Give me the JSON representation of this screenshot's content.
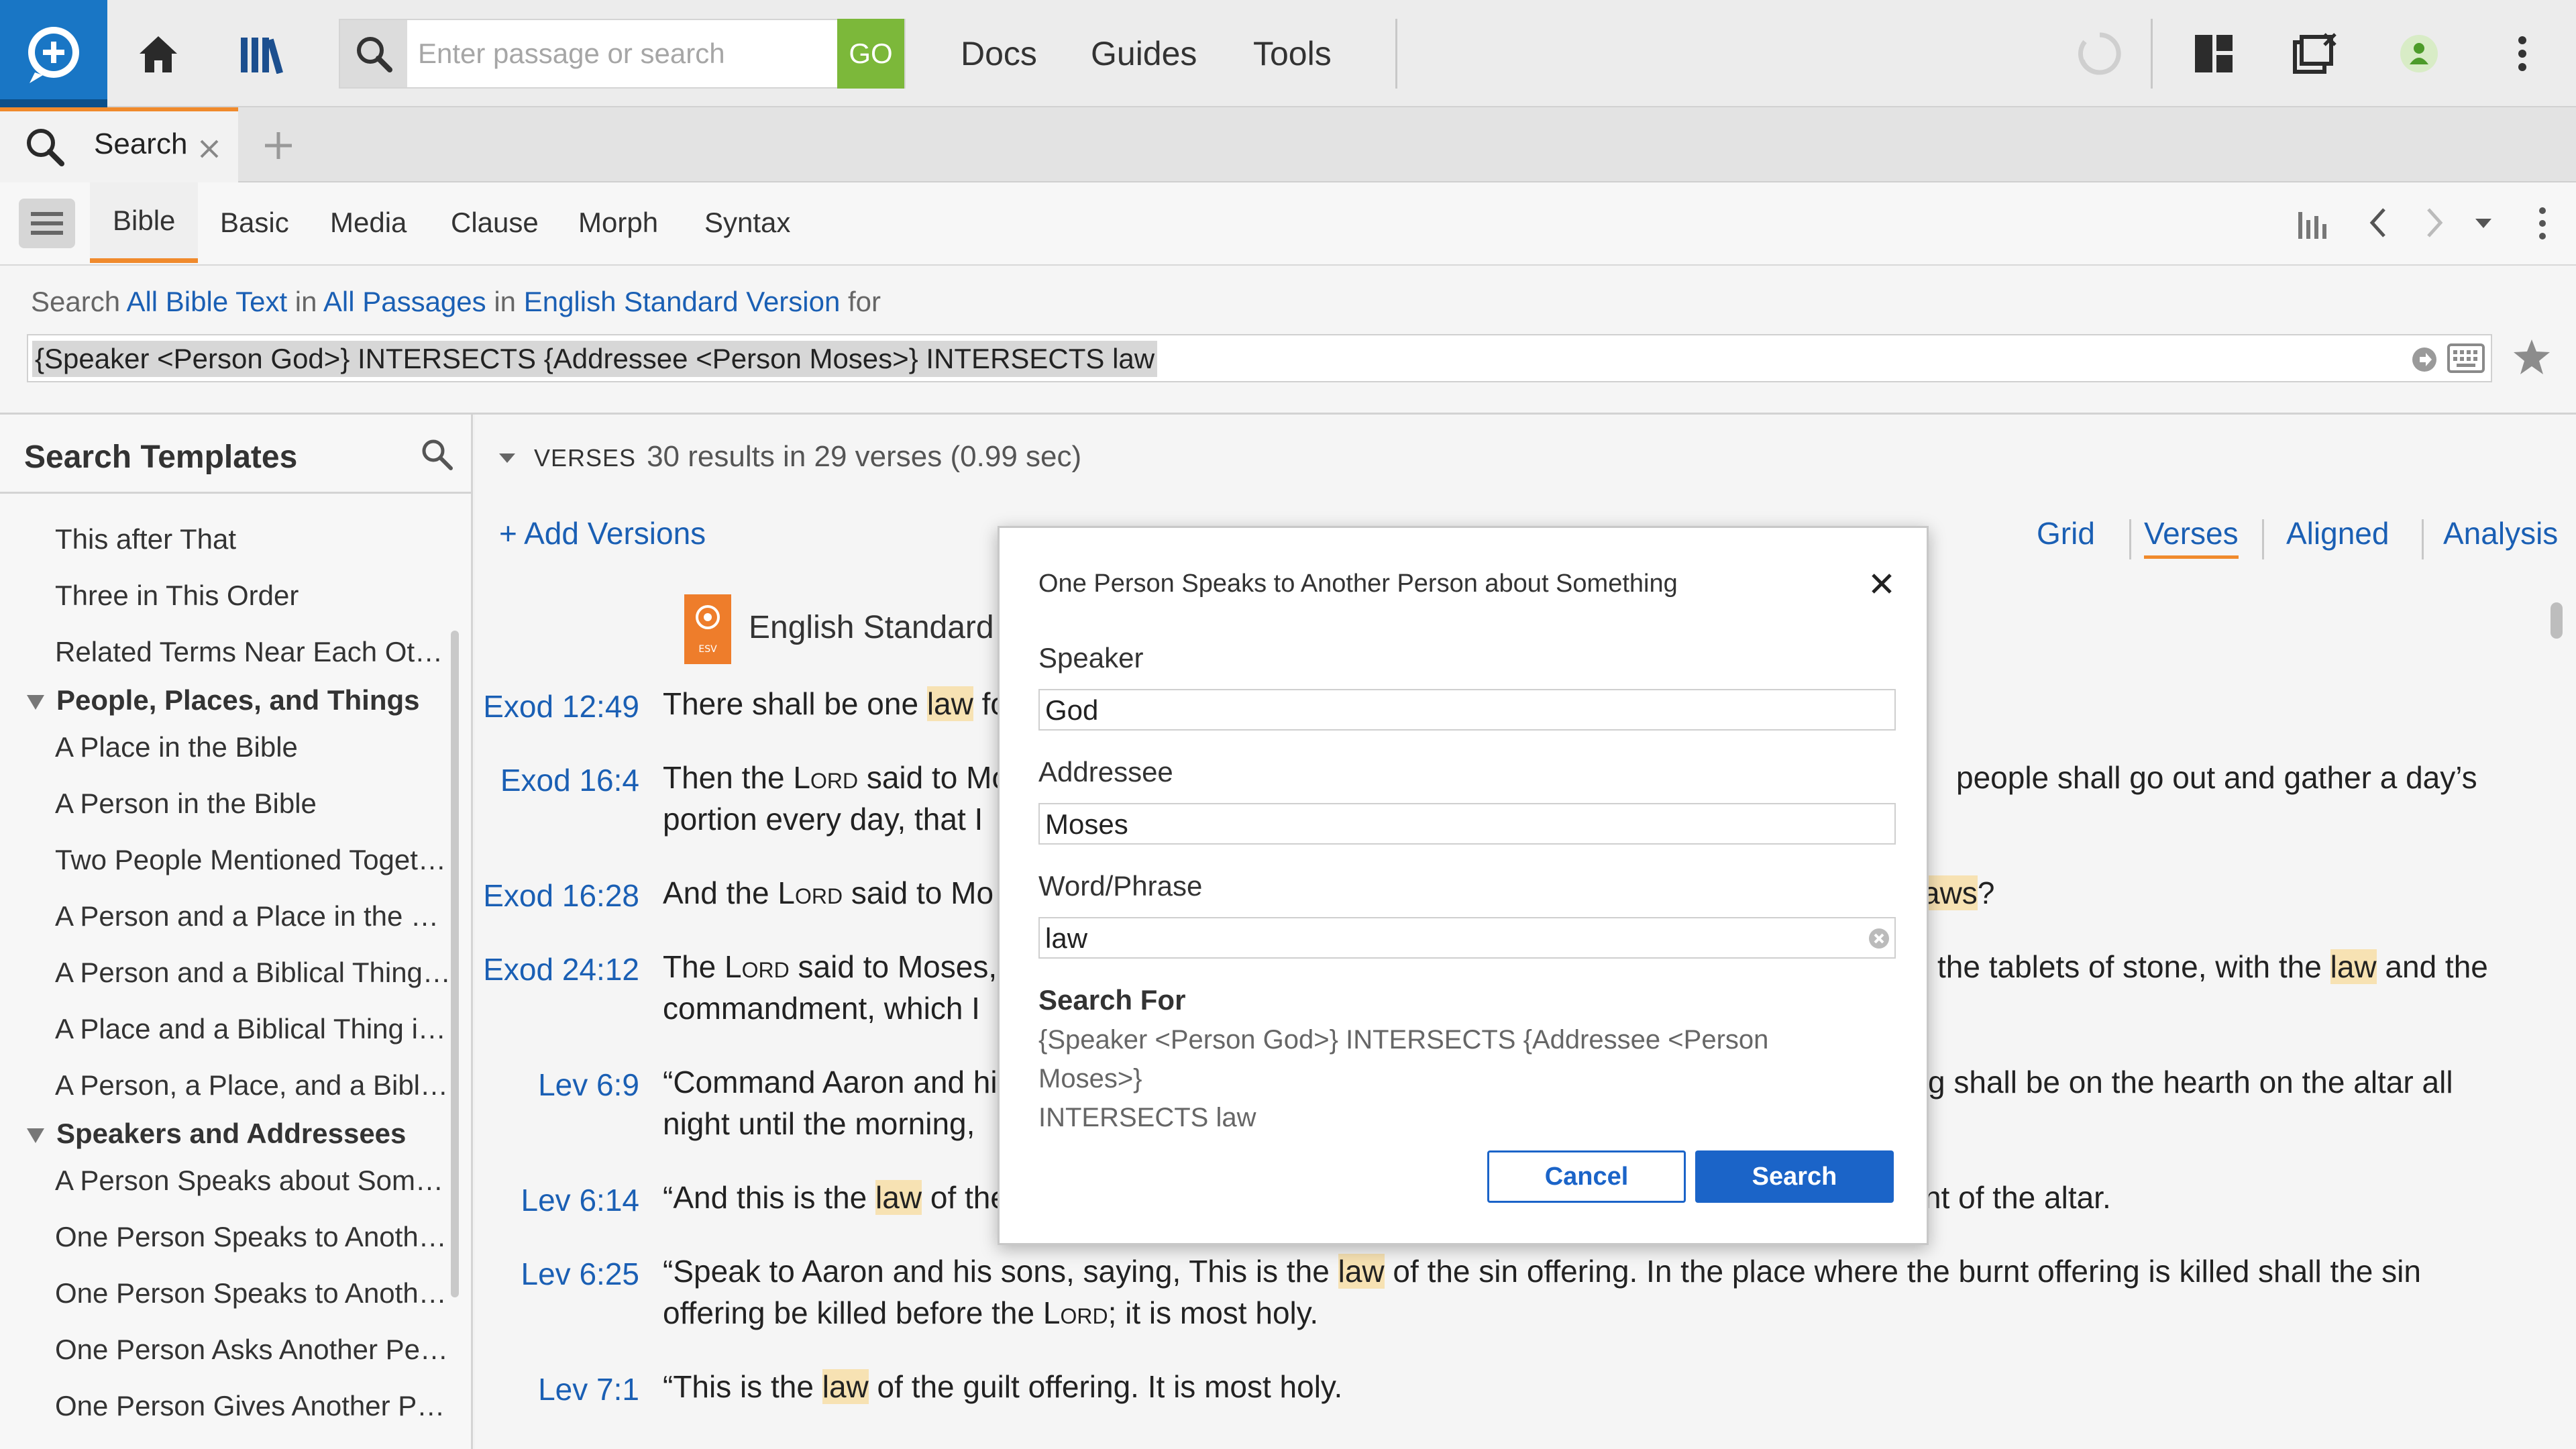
{
  "colors": {
    "accent": "#f08a2c",
    "link": "#1a5fb4",
    "go": "#7cb83a",
    "primary_button": "#1b64c8",
    "highlight": "#f7e2b3"
  },
  "toolbar": {
    "search_placeholder": "Enter passage or search",
    "go_label": "GO",
    "menu": [
      "Docs",
      "Guides",
      "Tools"
    ],
    "icons": [
      "logos-logo-icon",
      "home-icon",
      "library-icon",
      "search-icon",
      "sync-icon",
      "layouts-icon",
      "close-panels-icon",
      "user-avatar-icon",
      "more-icon"
    ]
  },
  "tabs": {
    "active": "Search"
  },
  "search_types": [
    "Bible",
    "Basic",
    "Media",
    "Clause",
    "Morph",
    "Syntax"
  ],
  "scope": {
    "search_word": "Search",
    "content": "All Bible Text",
    "in1": "in",
    "passages": "All Passages",
    "in2": "in",
    "version": "English Standard Version",
    "for_word": "for"
  },
  "query": "{Speaker <Person God>} INTERSECTS {Addressee <Person Moses>} INTERSECTS law",
  "templates_panel": {
    "title": "Search Templates",
    "items": [
      {
        "label": "This after That",
        "kind": "item"
      },
      {
        "label": "Three in This Order",
        "kind": "item"
      },
      {
        "label": "Related Terms Near Each Other",
        "kind": "item"
      },
      {
        "label": "People, Places, and Things",
        "kind": "group"
      },
      {
        "label": "A Place in the Bible",
        "kind": "item"
      },
      {
        "label": "A Person in the Bible",
        "kind": "item"
      },
      {
        "label": "Two People Mentioned Together",
        "kind": "item"
      },
      {
        "label": "A Person and a Place in the Same Verse",
        "kind": "item"
      },
      {
        "label": "A Person and a Biblical Thing in the Same Verse",
        "kind": "item"
      },
      {
        "label": "A Place and a Biblical Thing in the Same Verse",
        "kind": "item"
      },
      {
        "label": "A Person, a Place, and a Biblical Thing",
        "kind": "item"
      },
      {
        "label": "Speakers and Addressees",
        "kind": "group"
      },
      {
        "label": "A Person Speaks about Something",
        "kind": "item"
      },
      {
        "label": "One Person Speaks to Another Person",
        "kind": "item"
      },
      {
        "label": "One Person Speaks to Another Person about Something",
        "kind": "item"
      },
      {
        "label": "One Person Asks Another Person",
        "kind": "item"
      },
      {
        "label": "One Person Gives Another Person a Command",
        "kind": "item"
      }
    ]
  },
  "results": {
    "section_label": "VERSES",
    "summary": "30 results in 29 verses (0.99 sec)",
    "add_versions": "+ Add Versions",
    "views": [
      "Grid",
      "Verses",
      "Aligned",
      "Analysis"
    ],
    "active_view": "Verses",
    "version_name": "English Standard Version",
    "version_badge": "ESV"
  },
  "dialog": {
    "title": "One Person Speaks to Another Person about Something",
    "speaker_label": "Speaker",
    "speaker_value": "God",
    "addressee_label": "Addressee",
    "addressee_value": "Moses",
    "phrase_label": "Word/Phrase",
    "phrase_value": "law",
    "search_for_label": "Search For",
    "search_for_line1": "{Speaker <Person God>} INTERSECTS {Addressee <Person Moses>}",
    "search_for_line2": "INTERSECTS law",
    "cancel_label": "Cancel",
    "submit_label": "Search"
  }
}
